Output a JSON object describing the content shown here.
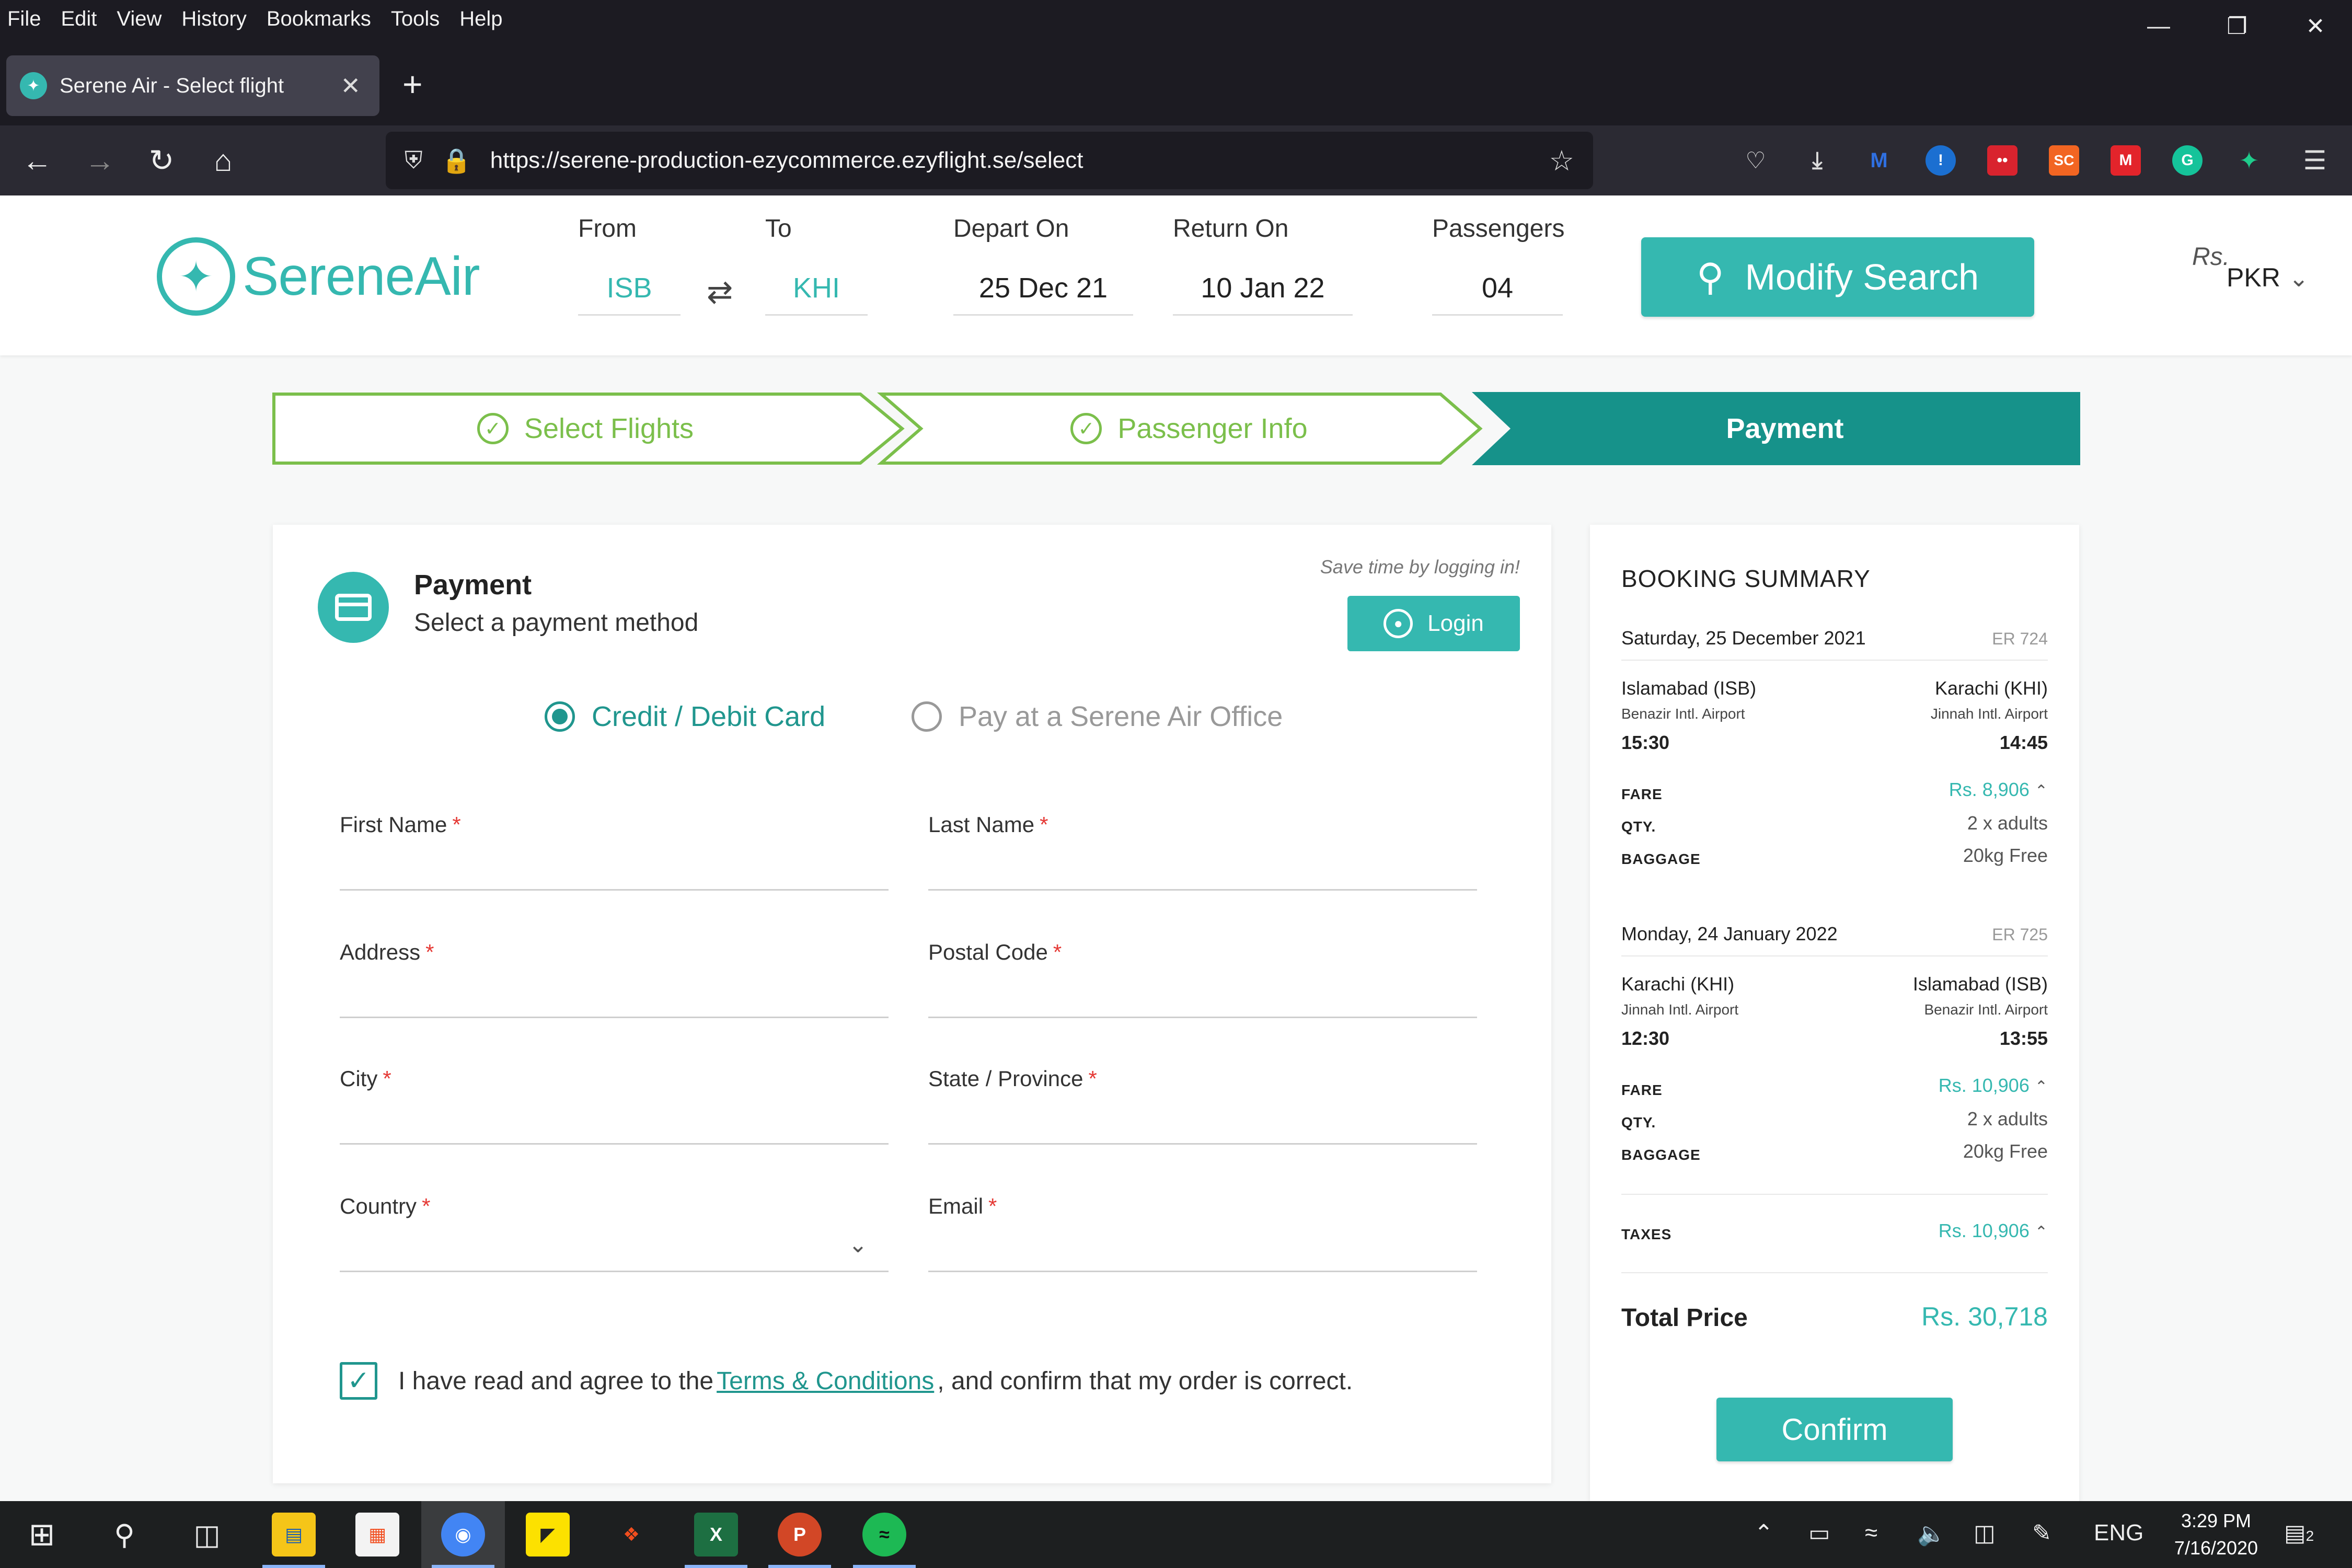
{
  "browser": {
    "menu": [
      "File",
      "Edit",
      "View",
      "History",
      "Bookmarks",
      "Tools",
      "Help"
    ],
    "tab_title": "Serene Air - Select flight",
    "url": "https://serene-production-ezycommerce.ezyflight.se/select",
    "extensions": [
      "pocket-icon",
      "download-icon",
      "malwarebytes-icon",
      "lastpass-icon",
      "ext-red-icon",
      "sc-icon",
      "ext-red2-icon",
      "grammarly-icon",
      "ext-green-icon",
      "menu-icon"
    ],
    "ext_sc_label": "SC"
  },
  "brand": {
    "name_light": "Serene",
    "name_bold": "Air",
    "color": "#35b8b0"
  },
  "search": {
    "from_label": "From",
    "from_value": "ISB",
    "to_label": "To",
    "to_value": "KHI",
    "depart_label": "Depart On",
    "depart_value": "25 Dec 21",
    "return_label": "Return On",
    "return_value": "10 Jan 22",
    "passengers_label": "Passengers",
    "passengers_value": "04",
    "modify_label": "Modify Search",
    "currency_symbol": "Rs.",
    "currency": "PKR"
  },
  "steps": [
    {
      "label": "Select Flights",
      "state": "done"
    },
    {
      "label": "Passenger Info",
      "state": "done"
    },
    {
      "label": "Payment",
      "state": "active"
    }
  ],
  "payment": {
    "title": "Payment",
    "subtitle": "Select a payment method",
    "save_hint": "Save time by logging in!",
    "login_label": "Login",
    "method_card": "Credit / Debit Card",
    "method_office": "Pay at a Serene Air Office",
    "fields": {
      "first_name": "First Name",
      "last_name": "Last Name",
      "address": "Address",
      "postal_code": "Postal Code",
      "city": "City",
      "state": "State / Province",
      "country": "Country",
      "email": "Email"
    },
    "required_mark": "*",
    "agree_prefix": "I have read and agree to the",
    "agree_link": "Terms & Conditions",
    "agree_suffix": ", and confirm that my order is correct."
  },
  "summary": {
    "title": "BOOKING SUMMARY",
    "legs": [
      {
        "date": "Saturday, 25 December 2021",
        "flight": "ER 724",
        "from_city": "Islamabad (ISB)",
        "from_airport": "Benazir Intl. Airport",
        "from_time": "15:30",
        "to_city": "Karachi (KHI)",
        "to_airport": "Jinnah Intl. Airport",
        "to_time": "14:45",
        "fare_label": "FARE",
        "fare": "Rs. 8,906",
        "qty_label": "QTY.",
        "qty": "2 x adults",
        "baggage_label": "BAGGAGE",
        "baggage": "20kg Free"
      },
      {
        "date": "Monday, 24 January 2022",
        "flight": "ER 725",
        "from_city": "Karachi (KHI)",
        "from_airport": "Jinnah Intl. Airport",
        "from_time": "12:30",
        "to_city": "Islamabad (ISB)",
        "to_airport": "Benazir Intl. Airport",
        "to_time": "13:55",
        "fare_label": "FARE",
        "fare": "Rs. 10,906",
        "qty_label": "QTY.",
        "qty": "2 x adults",
        "baggage_label": "BAGGAGE",
        "baggage": "20kg Free"
      }
    ],
    "taxes_label": "TAXES",
    "taxes": "Rs. 10,906",
    "total_label": "Total Price",
    "total": "Rs. 30,718",
    "confirm_label": "Confirm"
  },
  "taskbar": {
    "lang": "ENG",
    "time": "3:29 PM",
    "date": "7/16/2020",
    "notifications": "2"
  }
}
